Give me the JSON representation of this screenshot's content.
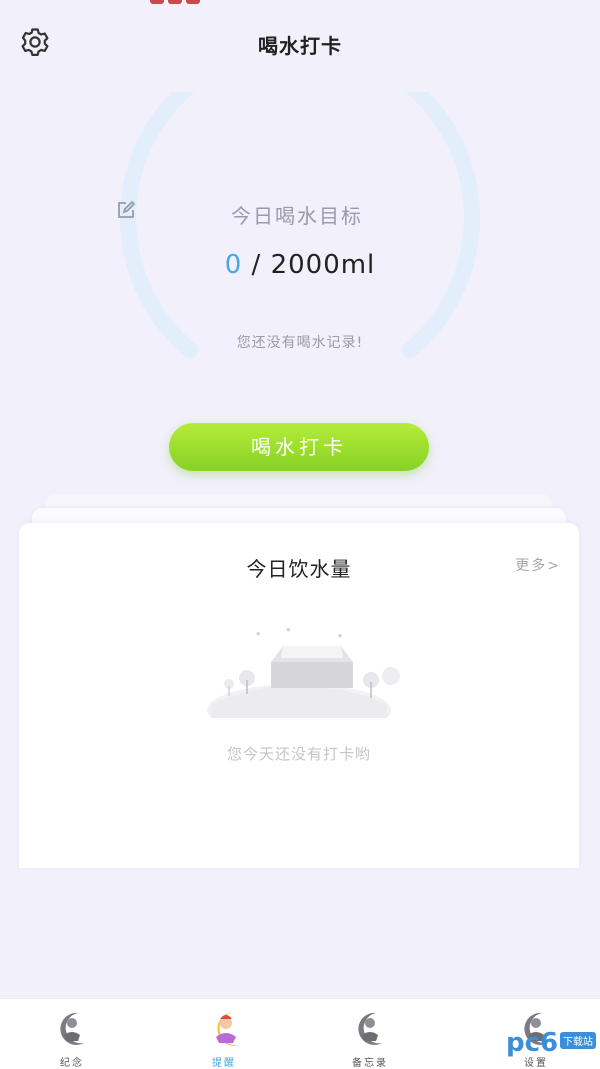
{
  "header": {
    "title": "喝水打卡"
  },
  "icons": {
    "settings": "gear-icon",
    "edit": "edit-icon"
  },
  "goal": {
    "label": "今日喝水目标",
    "current": "0",
    "separator": " / ",
    "target": "2000ml",
    "progress": 0,
    "hint": "您还没有喝水记录!"
  },
  "checkin_button": "喝水打卡",
  "card": {
    "title": "今日饮水量",
    "more": "更多>",
    "empty_text": "您今天还没有打卡哟"
  },
  "tabs": [
    {
      "label": "纪念",
      "icon": "moon-character-icon",
      "active": false
    },
    {
      "label": "提醒",
      "icon": "moon-character-icon",
      "active": true
    },
    {
      "label": "备忘录",
      "icon": "moon-character-icon",
      "active": false
    },
    {
      "label": "设置",
      "icon": "moon-character-icon",
      "active": false
    }
  ],
  "watermark": {
    "brand": "pc6",
    "tag": "下载站"
  },
  "colors": {
    "background": "#f1f0fb",
    "accent_blue": "#49a6e6",
    "button_green": "#9ee02f",
    "gauge_track": "#e3eefc"
  }
}
